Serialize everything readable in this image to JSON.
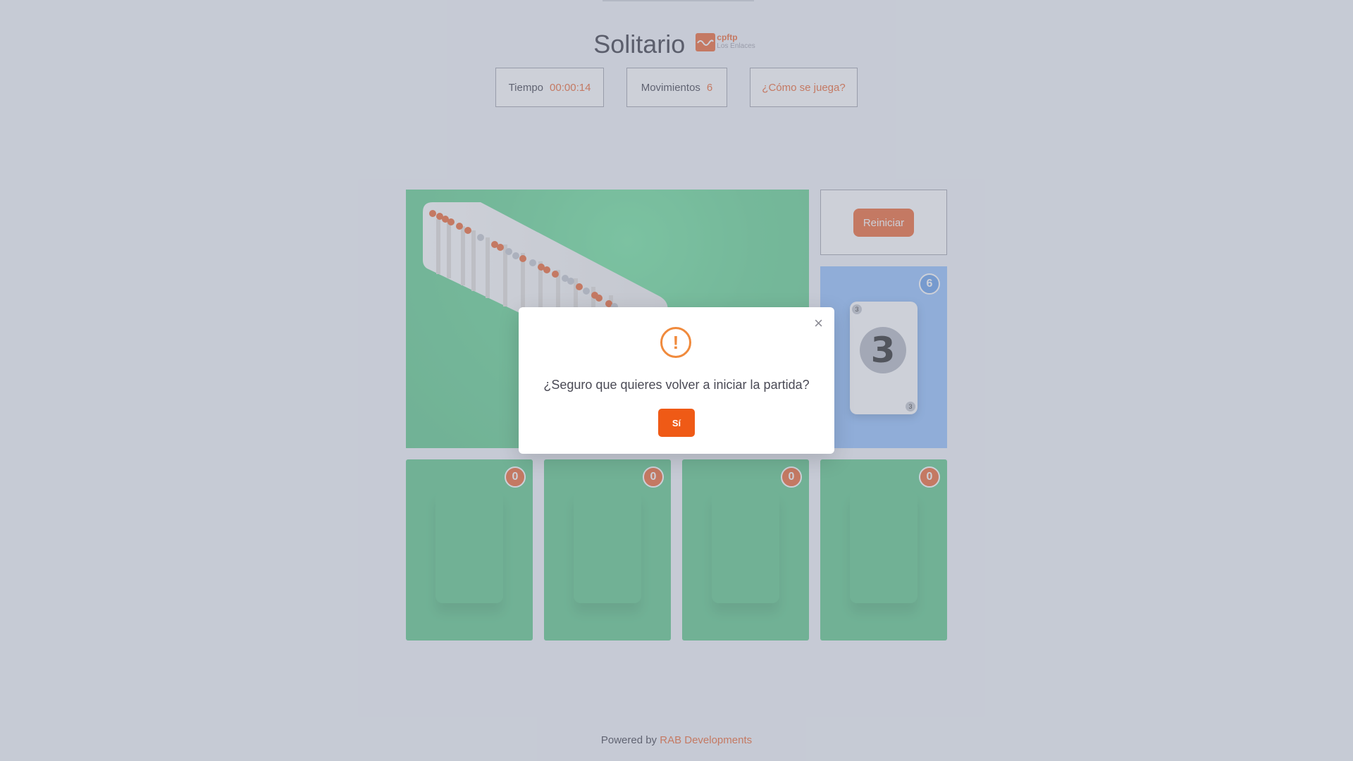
{
  "header": {
    "title": "Solitario",
    "logo_line1": "cpftp",
    "logo_line2": "Los Enlaces"
  },
  "stats": {
    "time_label": "Tiempo",
    "time_value": "00:00:14",
    "moves_label": "Movimientos",
    "moves_value": "6",
    "help_label": "¿Cómo se juega?"
  },
  "controls": {
    "reset_label": "Reiniciar"
  },
  "stock": {
    "count": "6",
    "top_card_value": "3"
  },
  "foundations": [
    {
      "count": "0"
    },
    {
      "count": "0"
    },
    {
      "count": "0"
    },
    {
      "count": "0"
    }
  ],
  "modal": {
    "message": "¿Seguro que quieres volver a iniciar la partida?",
    "confirm_label": "Sí",
    "close_symbol": "×",
    "warning_symbol": "!"
  },
  "footer": {
    "prefix": "Powered by",
    "link": "RAB Developments"
  },
  "colors": {
    "accent": "#f06f3c",
    "table_green": "#66cc90",
    "stock_blue": "#99c5ff",
    "confirm_button": "#ef5a16"
  }
}
